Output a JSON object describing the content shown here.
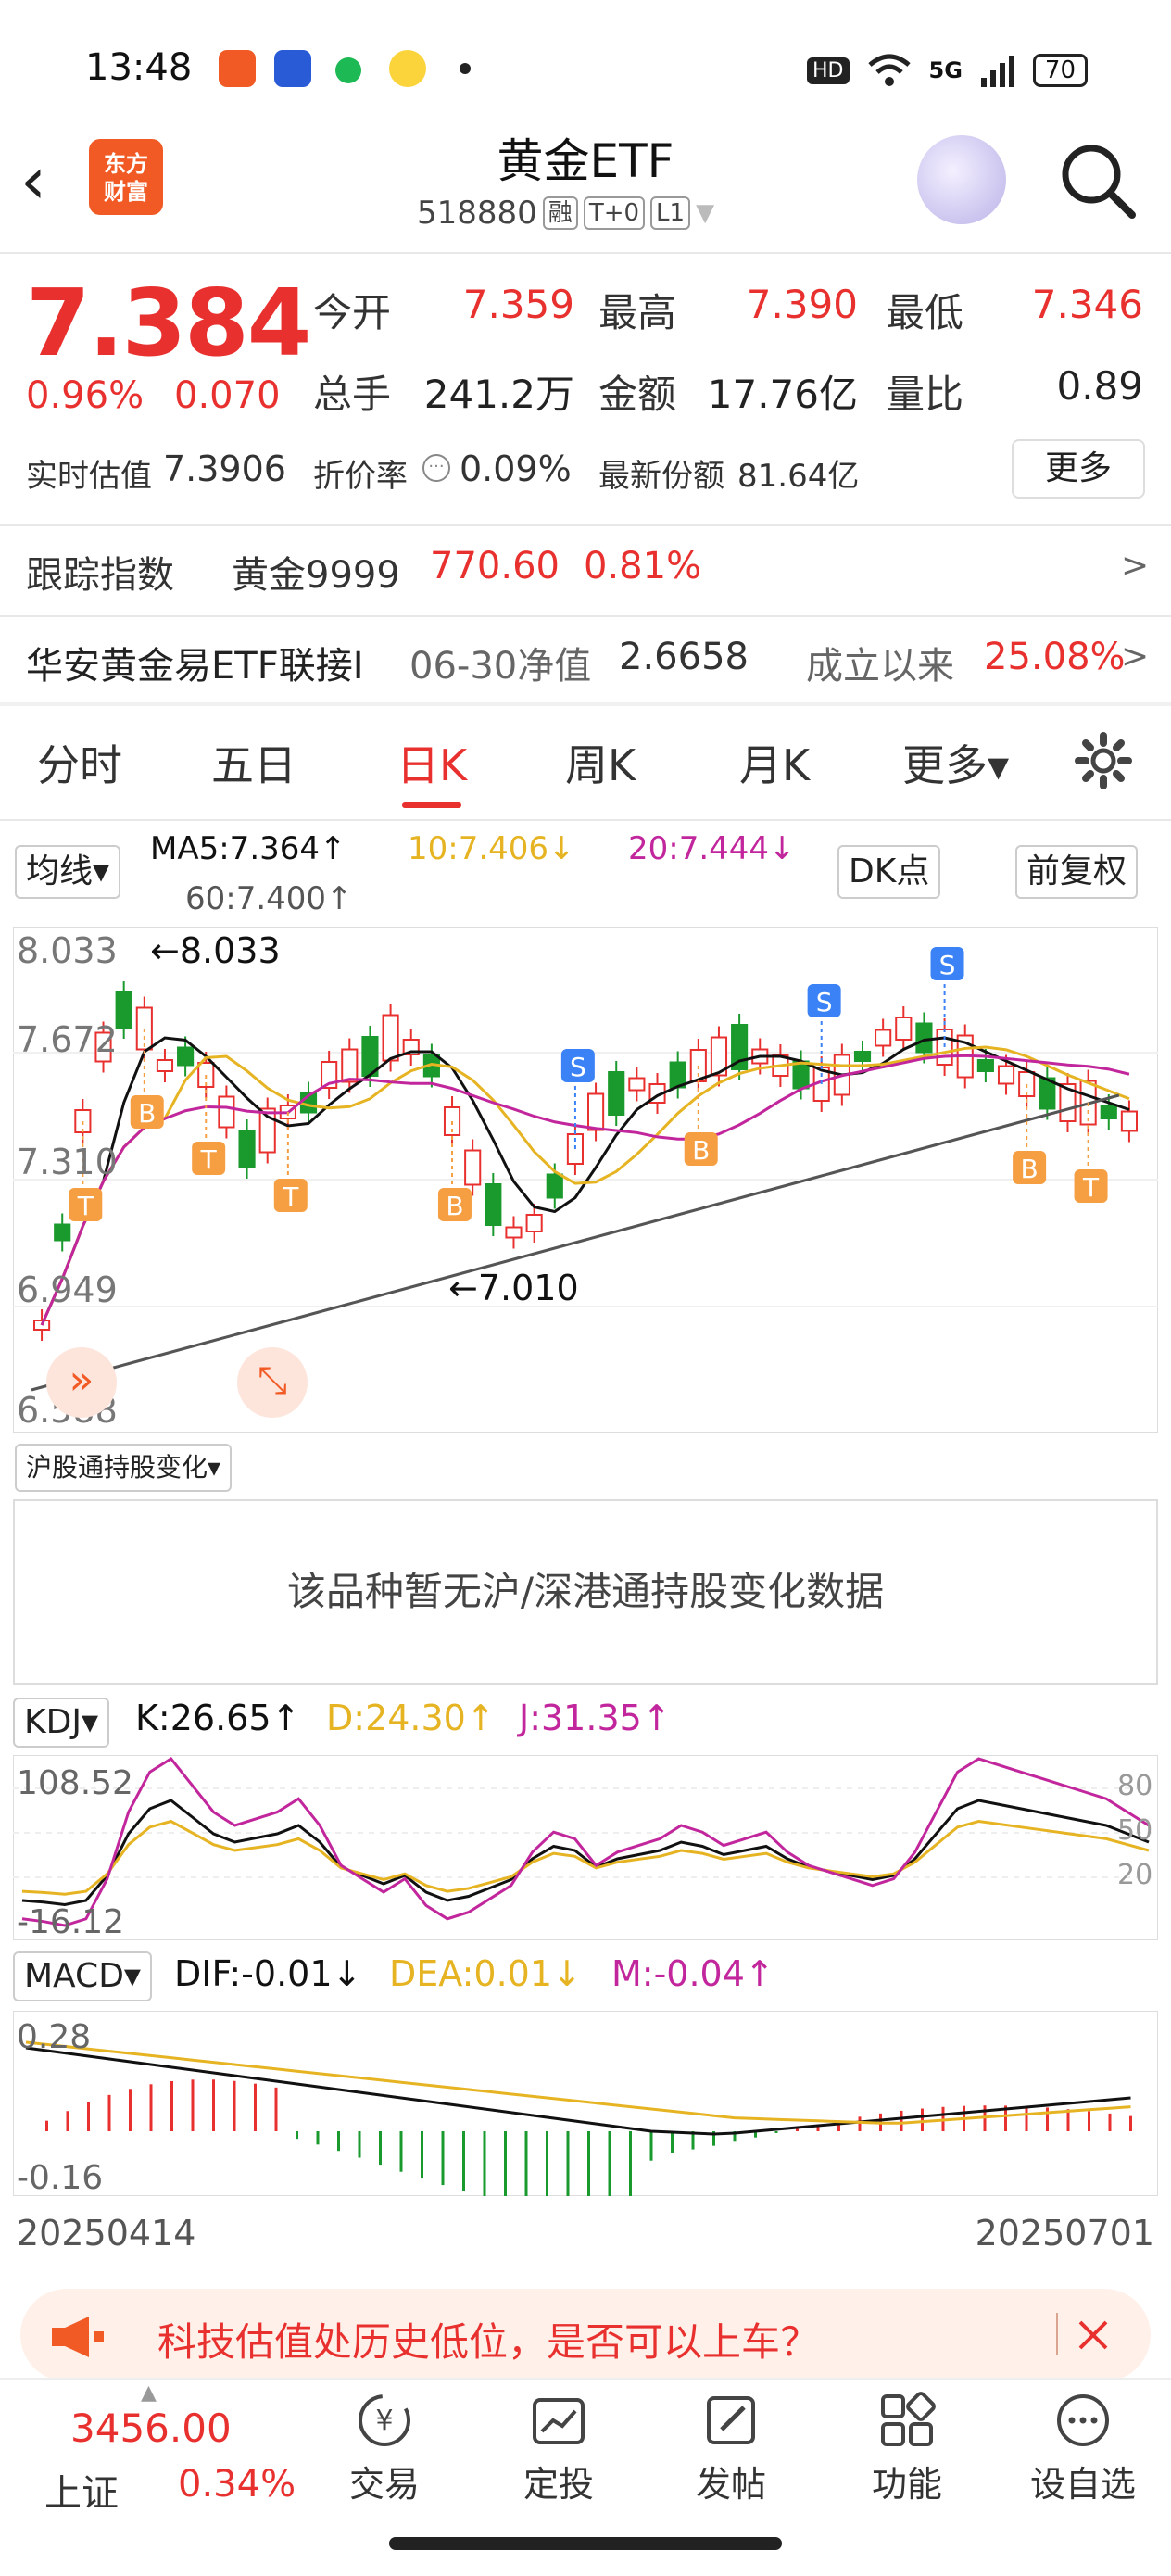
{
  "status": {
    "time": "13:48",
    "network": "5G",
    "battery": "70",
    "hd": "HD"
  },
  "header": {
    "logo_line1": "东方",
    "logo_line2": "财富",
    "title": "黄金ETF",
    "code": "518880",
    "tags": [
      "融",
      "T+0",
      "L1"
    ]
  },
  "quote": {
    "price": "7.384",
    "change_pct": "0.96%",
    "change_amt": "0.070",
    "open_label": "今开",
    "open": "7.359",
    "high_label": "最高",
    "high": "7.390",
    "low_label": "最低",
    "low": "7.346",
    "vol_label": "总手",
    "vol": "241.2万",
    "amount_label": "金额",
    "amount": "17.76亿",
    "ratio_label": "量比",
    "ratio": "0.89",
    "iopv_label": "实时估值",
    "iopv": "7.3906",
    "premium_label": "折价率",
    "premium": "0.09%",
    "shares_label": "最新份额",
    "shares": "81.64亿",
    "more": "更多"
  },
  "tracking": {
    "label": "跟踪指数",
    "name": "黄金9999",
    "value": "770.60",
    "pct": "0.81%",
    "arrow": ">"
  },
  "fund": {
    "name": "华安黄金易ETF联接I",
    "nav_label": "06-30净值",
    "nav": "2.6658",
    "since_label": "成立以来",
    "since": "25.08%",
    "arrow": ">"
  },
  "tabs": [
    "分时",
    "五日",
    "日K",
    "周K",
    "月K",
    "更多▾"
  ],
  "ma": {
    "dropdown": "均线▾",
    "ma5": "MA5:7.364↑",
    "ma10": "10:7.406↓",
    "ma20": "20:7.444↓",
    "ma60": "60:7.400↑",
    "dk": "DK点",
    "fq": "前复权"
  },
  "kline": {
    "y_labels": [
      "8.033",
      "7.672",
      "7.310",
      "6.949",
      "6.588"
    ],
    "max_mark": "←8.033",
    "min_mark": "←7.010"
  },
  "hk_flow": {
    "dropdown": "沪股通持股变化▾",
    "notice": "该品种暂无沪/深港通持股变化数据"
  },
  "kdj": {
    "dropdown": "KDJ▾",
    "k": "K:26.65↑",
    "d": "D:24.30↑",
    "j": "J:31.35↑",
    "top": "108.52",
    "bottom": "-16.12",
    "levels": [
      "80",
      "50",
      "20"
    ]
  },
  "macd": {
    "dropdown": "MACD▾",
    "dif": "DIF:-0.01↓",
    "dea": "DEA:0.01↓",
    "m": "M:-0.04↑",
    "top": "0.28",
    "bottom": "-0.16"
  },
  "dates": {
    "start": "20250414",
    "end": "20250701"
  },
  "ad": {
    "text": "科技估值处历史低位，是否可以上车？"
  },
  "bottom": {
    "index_value": "3456.00",
    "index_name": "上证",
    "index_pct": "0.34%",
    "items": [
      "交易",
      "定投",
      "发帖",
      "功能",
      "设自选"
    ]
  },
  "colors": {
    "up": "#e8312f",
    "down": "#1a9a2c",
    "ma5": "#111111",
    "ma10": "#e6b422",
    "ma20": "#c2269c",
    "ma60": "#555555"
  }
}
